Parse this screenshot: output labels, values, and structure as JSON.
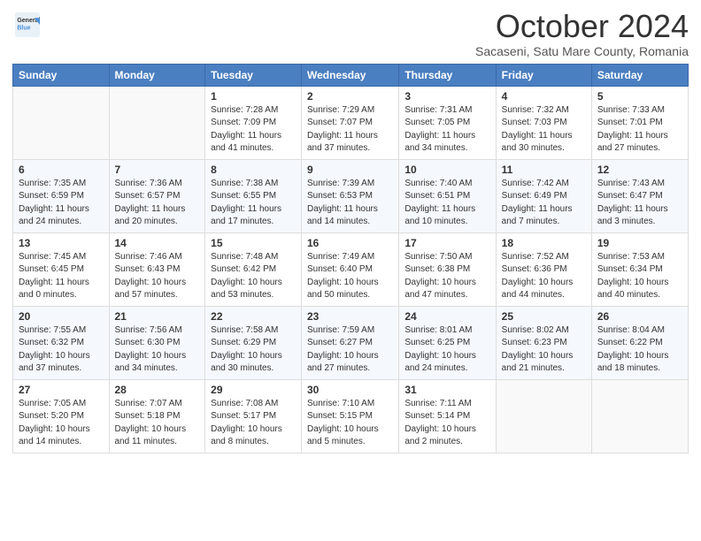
{
  "header": {
    "logo": {
      "line1": "General",
      "line2": "Blue"
    },
    "month": "October 2024",
    "location": "Sacaseni, Satu Mare County, Romania"
  },
  "weekdays": [
    "Sunday",
    "Monday",
    "Tuesday",
    "Wednesday",
    "Thursday",
    "Friday",
    "Saturday"
  ],
  "weeks": [
    [
      {
        "day": "",
        "info": ""
      },
      {
        "day": "",
        "info": ""
      },
      {
        "day": "1",
        "info": "Sunrise: 7:28 AM\nSunset: 7:09 PM\nDaylight: 11 hours and 41 minutes."
      },
      {
        "day": "2",
        "info": "Sunrise: 7:29 AM\nSunset: 7:07 PM\nDaylight: 11 hours and 37 minutes."
      },
      {
        "day": "3",
        "info": "Sunrise: 7:31 AM\nSunset: 7:05 PM\nDaylight: 11 hours and 34 minutes."
      },
      {
        "day": "4",
        "info": "Sunrise: 7:32 AM\nSunset: 7:03 PM\nDaylight: 11 hours and 30 minutes."
      },
      {
        "day": "5",
        "info": "Sunrise: 7:33 AM\nSunset: 7:01 PM\nDaylight: 11 hours and 27 minutes."
      }
    ],
    [
      {
        "day": "6",
        "info": "Sunrise: 7:35 AM\nSunset: 6:59 PM\nDaylight: 11 hours and 24 minutes."
      },
      {
        "day": "7",
        "info": "Sunrise: 7:36 AM\nSunset: 6:57 PM\nDaylight: 11 hours and 20 minutes."
      },
      {
        "day": "8",
        "info": "Sunrise: 7:38 AM\nSunset: 6:55 PM\nDaylight: 11 hours and 17 minutes."
      },
      {
        "day": "9",
        "info": "Sunrise: 7:39 AM\nSunset: 6:53 PM\nDaylight: 11 hours and 14 minutes."
      },
      {
        "day": "10",
        "info": "Sunrise: 7:40 AM\nSunset: 6:51 PM\nDaylight: 11 hours and 10 minutes."
      },
      {
        "day": "11",
        "info": "Sunrise: 7:42 AM\nSunset: 6:49 PM\nDaylight: 11 hours and 7 minutes."
      },
      {
        "day": "12",
        "info": "Sunrise: 7:43 AM\nSunset: 6:47 PM\nDaylight: 11 hours and 3 minutes."
      }
    ],
    [
      {
        "day": "13",
        "info": "Sunrise: 7:45 AM\nSunset: 6:45 PM\nDaylight: 11 hours and 0 minutes."
      },
      {
        "day": "14",
        "info": "Sunrise: 7:46 AM\nSunset: 6:43 PM\nDaylight: 10 hours and 57 minutes."
      },
      {
        "day": "15",
        "info": "Sunrise: 7:48 AM\nSunset: 6:42 PM\nDaylight: 10 hours and 53 minutes."
      },
      {
        "day": "16",
        "info": "Sunrise: 7:49 AM\nSunset: 6:40 PM\nDaylight: 10 hours and 50 minutes."
      },
      {
        "day": "17",
        "info": "Sunrise: 7:50 AM\nSunset: 6:38 PM\nDaylight: 10 hours and 47 minutes."
      },
      {
        "day": "18",
        "info": "Sunrise: 7:52 AM\nSunset: 6:36 PM\nDaylight: 10 hours and 44 minutes."
      },
      {
        "day": "19",
        "info": "Sunrise: 7:53 AM\nSunset: 6:34 PM\nDaylight: 10 hours and 40 minutes."
      }
    ],
    [
      {
        "day": "20",
        "info": "Sunrise: 7:55 AM\nSunset: 6:32 PM\nDaylight: 10 hours and 37 minutes."
      },
      {
        "day": "21",
        "info": "Sunrise: 7:56 AM\nSunset: 6:30 PM\nDaylight: 10 hours and 34 minutes."
      },
      {
        "day": "22",
        "info": "Sunrise: 7:58 AM\nSunset: 6:29 PM\nDaylight: 10 hours and 30 minutes."
      },
      {
        "day": "23",
        "info": "Sunrise: 7:59 AM\nSunset: 6:27 PM\nDaylight: 10 hours and 27 minutes."
      },
      {
        "day": "24",
        "info": "Sunrise: 8:01 AM\nSunset: 6:25 PM\nDaylight: 10 hours and 24 minutes."
      },
      {
        "day": "25",
        "info": "Sunrise: 8:02 AM\nSunset: 6:23 PM\nDaylight: 10 hours and 21 minutes."
      },
      {
        "day": "26",
        "info": "Sunrise: 8:04 AM\nSunset: 6:22 PM\nDaylight: 10 hours and 18 minutes."
      }
    ],
    [
      {
        "day": "27",
        "info": "Sunrise: 7:05 AM\nSunset: 5:20 PM\nDaylight: 10 hours and 14 minutes."
      },
      {
        "day": "28",
        "info": "Sunrise: 7:07 AM\nSunset: 5:18 PM\nDaylight: 10 hours and 11 minutes."
      },
      {
        "day": "29",
        "info": "Sunrise: 7:08 AM\nSunset: 5:17 PM\nDaylight: 10 hours and 8 minutes."
      },
      {
        "day": "30",
        "info": "Sunrise: 7:10 AM\nSunset: 5:15 PM\nDaylight: 10 hours and 5 minutes."
      },
      {
        "day": "31",
        "info": "Sunrise: 7:11 AM\nSunset: 5:14 PM\nDaylight: 10 hours and 2 minutes."
      },
      {
        "day": "",
        "info": ""
      },
      {
        "day": "",
        "info": ""
      }
    ]
  ]
}
